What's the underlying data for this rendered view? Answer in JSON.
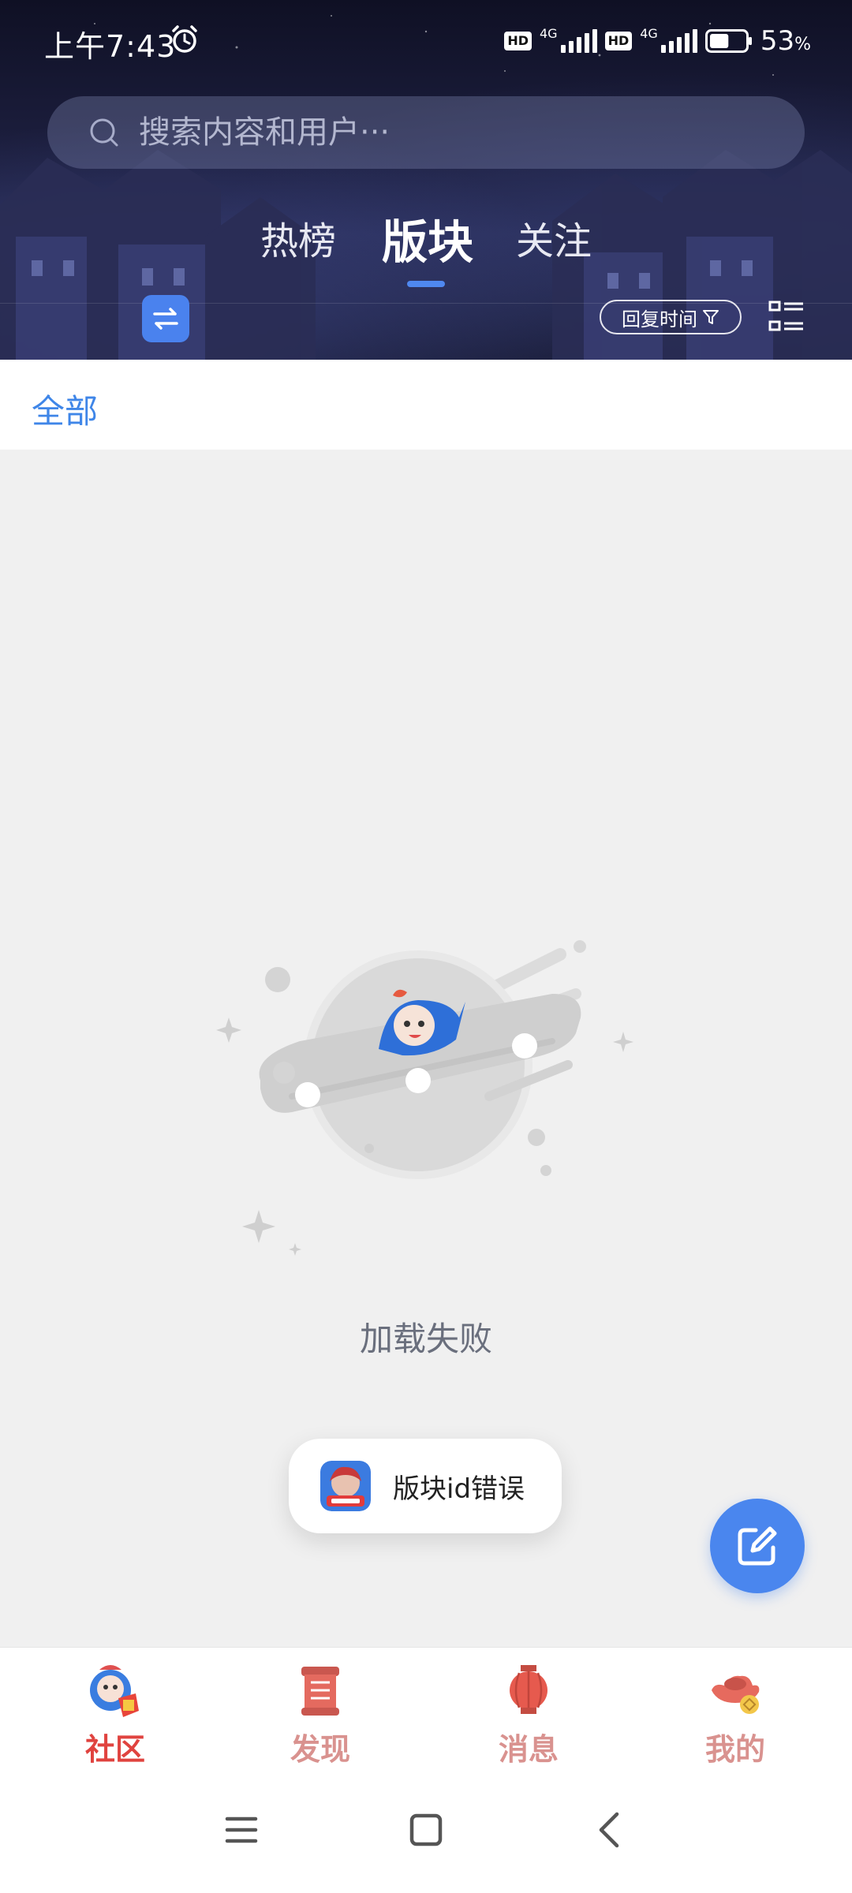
{
  "status_bar": {
    "time": "上午7:43",
    "hd1": "HD",
    "net1": "4G",
    "hd2": "HD",
    "net2": "4G",
    "battery_percent": "53",
    "battery_unit": "%",
    "battery_level": 0.53
  },
  "search": {
    "placeholder": "搜索内容和用户···"
  },
  "tabs": [
    {
      "label": "热榜",
      "active": false
    },
    {
      "label": "版块",
      "active": true
    },
    {
      "label": "关注",
      "active": false
    }
  ],
  "toolbar": {
    "sort_label": "回复时间",
    "sort_icon": "filter-icon"
  },
  "category": {
    "label": "全部"
  },
  "empty_state": {
    "message": "加载失败"
  },
  "toast": {
    "message": "版块id错误"
  },
  "bottom_nav": [
    {
      "label": "社区",
      "icon": "community-mascot-icon",
      "active": true
    },
    {
      "label": "发现",
      "icon": "discover-scroll-icon",
      "active": false
    },
    {
      "label": "消息",
      "icon": "lantern-icon",
      "active": false
    },
    {
      "label": "我的",
      "icon": "gold-ingot-icon",
      "active": false
    }
  ],
  "colors": {
    "accent": "#4a86ee",
    "nav_active": "#e0433f",
    "nav_inactive": "#d9928f",
    "category_text": "#3f86e8"
  }
}
